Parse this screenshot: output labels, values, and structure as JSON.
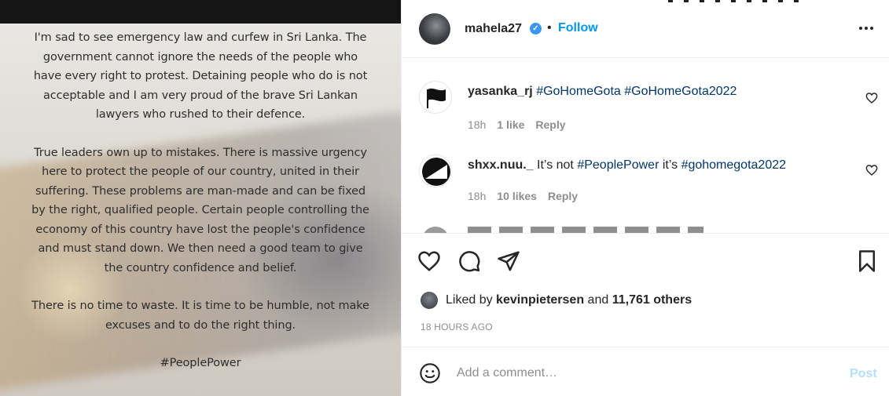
{
  "post": {
    "paragraphs": [
      "I'm sad to see emergency law and curfew in Sri Lanka. The government cannot ignore the needs of the people who have every right to protest. Detaining people who do is not acceptable and I am very proud of the brave Sri Lankan lawyers who rushed to their defence.",
      "True leaders own up to mistakes. There is massive urgency here to protect the people of our country, united in their suffering. These problems are man-made and can be fixed by the right, qualified people. Certain people controlling the economy of this country have lost the people's confidence and must stand down. We then need a good team to give the country confidence and belief.",
      "There is no time to waste. It is time to be humble, not make excuses and to do the right thing.",
      "#PeoplePower"
    ]
  },
  "header": {
    "username": "mahela27",
    "separator": "•",
    "follow_label": "Follow",
    "verified_glyph": "✓"
  },
  "comments": [
    {
      "user": "yasanka_rj",
      "text": "#GoHomeGota #GoHomeGota2022",
      "time": "18h",
      "likes": "1 like",
      "reply": "Reply"
    },
    {
      "user": "shxx.nuu._",
      "text_plain": "It’s not ",
      "tag1": "#PeoplePower",
      "text_mid": " it’s ",
      "tag2": "#gohomegota2022",
      "time": "18h",
      "likes": "10 likes",
      "reply": "Reply"
    }
  ],
  "likes": {
    "prefix": "Liked by ",
    "liker": "kevinpietersen",
    "mid": " and ",
    "others": "11,761 others"
  },
  "timestamp": "18 HOURS AGO",
  "composer": {
    "placeholder": "Add a comment…",
    "post_label": "Post"
  },
  "icons": [
    "heart-icon",
    "comment-icon",
    "share-icon",
    "bookmark-icon",
    "emoji-icon",
    "more-options-icon",
    "verified-badge-icon"
  ],
  "colors": {
    "link": "#0095f6",
    "hashtag": "#00376b",
    "muted": "#8e8e8e",
    "post_disabled": "#b2dffc"
  }
}
